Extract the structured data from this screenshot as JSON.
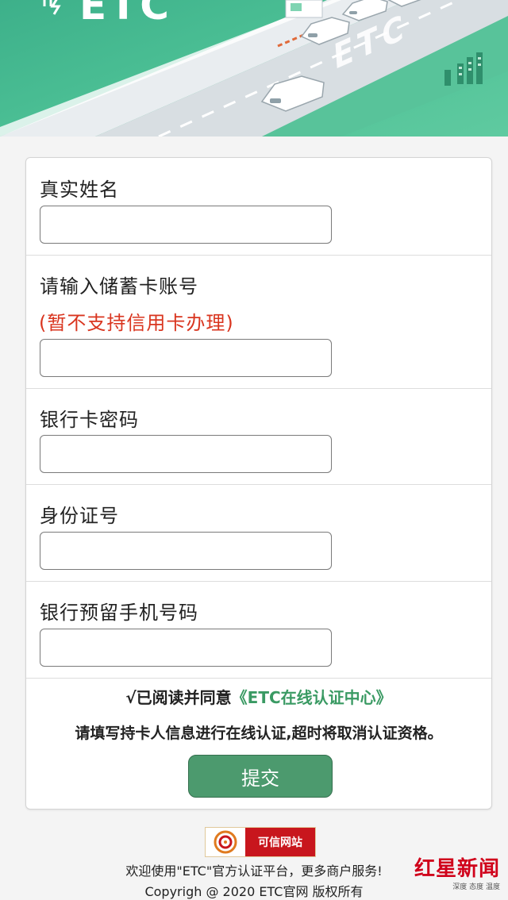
{
  "banner": {
    "logo_text": "ETC",
    "road_text": "ETC"
  },
  "form": {
    "fields": [
      {
        "label": "真实姓名",
        "value": "",
        "placeholder": ""
      },
      {
        "label": "请输入储蓄卡账号",
        "note": "(暂不支持信用卡办理)",
        "value": "",
        "placeholder": ""
      },
      {
        "label": "银行卡密码",
        "value": "",
        "placeholder": ""
      },
      {
        "label": "身份证号",
        "value": "",
        "placeholder": ""
      },
      {
        "label": "银行预留手机号码",
        "value": "",
        "placeholder": ""
      }
    ],
    "agree_prefix": "√已阅读并同意",
    "agree_link": "《ETC在线认证中心》",
    "notice": "请填写持卡人信息进行在线认证,超时将取消认证资格。",
    "submit_label": "提交"
  },
  "footer": {
    "badge_text": "可信网站",
    "welcome": "欢迎使用\"ETC\"官方认证平台，更多商户服务!",
    "copyright": "Copyrigh @ 2020 ETC官网 版权所有"
  },
  "watermark": {
    "title": "红星新闻",
    "subtitle": "深度 态度 温度"
  },
  "colors": {
    "banner": "#4cc095",
    "submit": "#4c9a6e",
    "link": "#3a9a63",
    "warning": "#d9351f",
    "badge_red": "#c8161d"
  }
}
